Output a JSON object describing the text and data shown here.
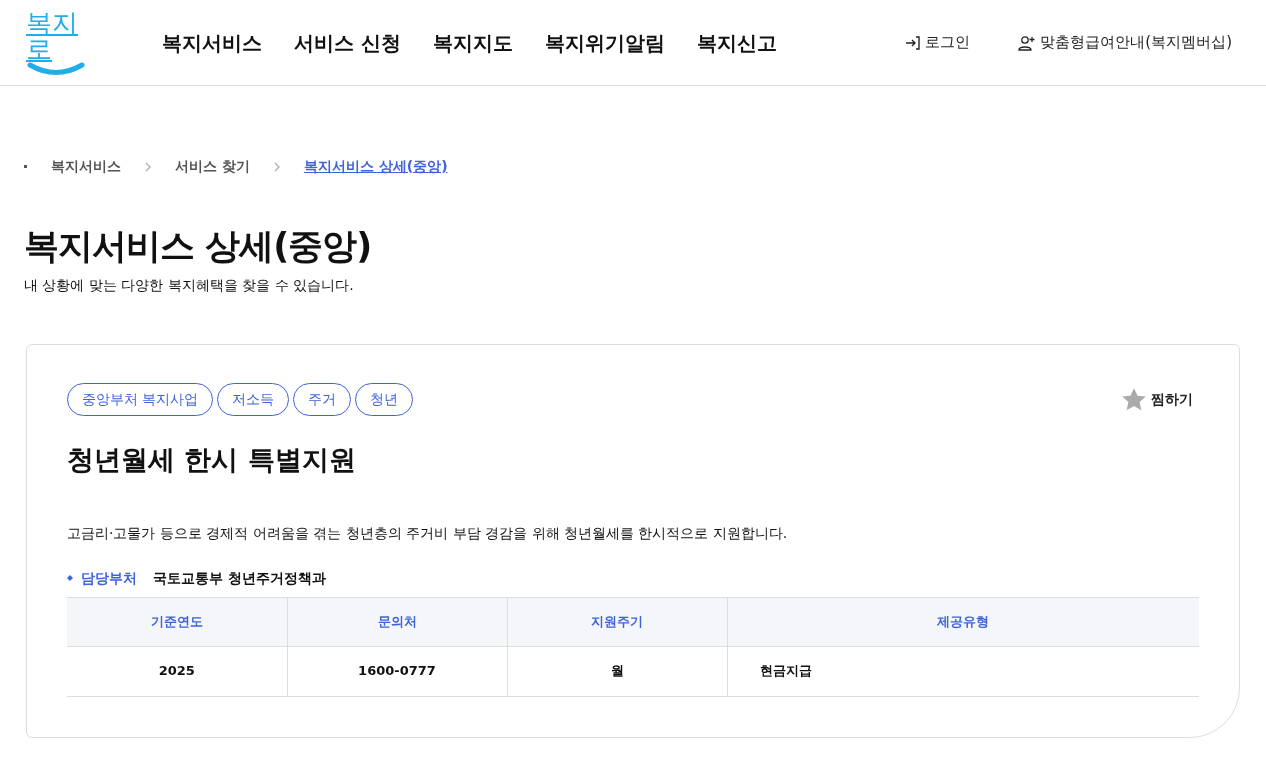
{
  "header": {
    "logo": "복지로",
    "nav": [
      "복지서비스",
      "서비스 신청",
      "복지지도",
      "복지위기알림",
      "복지신고"
    ],
    "login": "로그인",
    "membership": "맞춤형급여안내(복지멤버십)"
  },
  "breadcrumb": [
    {
      "label": "복지서비스",
      "current": false
    },
    {
      "label": "서비스 찾기",
      "current": false
    },
    {
      "label": "복지서비스 상세(중앙)",
      "current": true
    }
  ],
  "page_title": "복지서비스 상세(중앙)",
  "page_subtitle": "내 상황에 맞는 다양한 복지혜택을 찾을 수 있습니다.",
  "service": {
    "tags": [
      "중앙부처 복지사업",
      "저소득",
      "주거",
      "청년"
    ],
    "favorite": {
      "label": "찜하기",
      "on": false
    },
    "title": "청년월세 한시 특별지원",
    "description": "고금리·고물가 등으로 경제적 어려움을 겪는 청년층의 주거비 부담 경감을 위해 청년월세를 한시적으로 지원합니다.",
    "department": {
      "label": "담당부처",
      "value": "국토교통부 청년주거정책과"
    },
    "table": {
      "columns": [
        "기준연도",
        "문의처",
        "지원주기",
        "제공유형"
      ],
      "rows": [
        [
          "2025",
          "1600-0777",
          "월",
          "현금지급"
        ]
      ]
    }
  }
}
